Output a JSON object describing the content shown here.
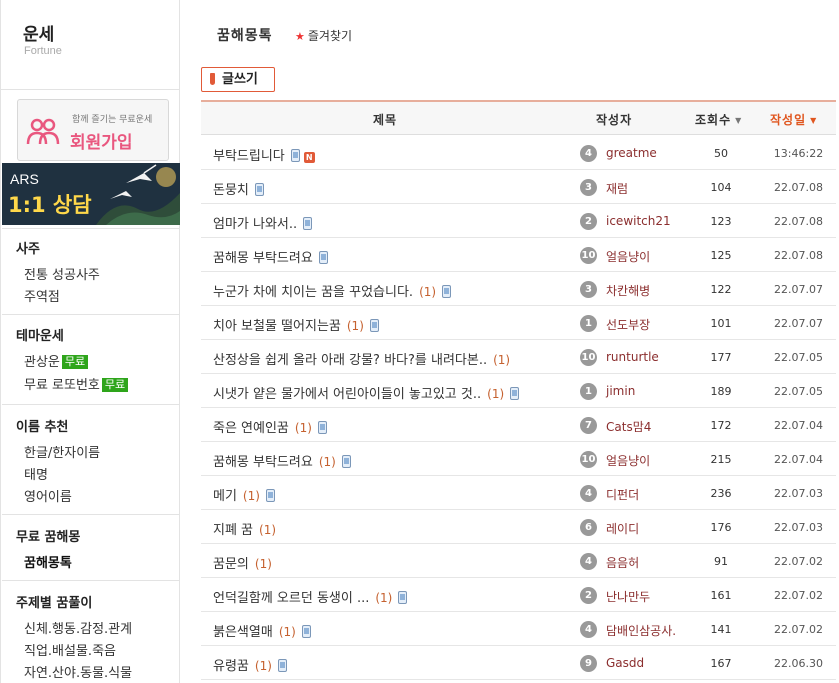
{
  "sidebar": {
    "title": "운세",
    "subtitle": "Fortune",
    "join_banner": {
      "top_text": "함께 즐기는 무료운세",
      "main_text": "회원가입"
    },
    "ars_banner": {
      "line1": "ARS",
      "line2": "1:1 상담"
    },
    "groups": [
      {
        "head": "사주",
        "items": [
          "전통 성공사주",
          "주역점"
        ]
      },
      {
        "head": "테마운세",
        "items": [
          "관상운",
          "무료 로또번호"
        ]
      },
      {
        "head": "이름 추천",
        "items": [
          "한글/한자이름",
          "태명",
          "영어이름"
        ]
      },
      {
        "head": "무료 꿈해몽",
        "items": [
          "꿈해몽톡"
        ]
      },
      {
        "head": "주제별 꿈풀이",
        "items": [
          "신체.행동.감정.관계",
          "직업.배설물.죽음",
          "자연.산야.동물.식물"
        ]
      }
    ],
    "free_badge": "무료"
  },
  "header": {
    "title": "꿈해몽톡",
    "favorite": "즐겨찾기"
  },
  "toolbar": {
    "write_label": "글쓰기"
  },
  "table": {
    "columns": {
      "title": "제목",
      "author": "작성자",
      "views": "조회수",
      "date": "작성일"
    },
    "rows": [
      {
        "title": "부탁드립니다",
        "comments": "",
        "mobile": true,
        "is_new": true,
        "level": "4",
        "author": "greatme",
        "views": "50",
        "date": "13:46:22"
      },
      {
        "title": "돈뭉치",
        "comments": "",
        "mobile": true,
        "is_new": false,
        "level": "3",
        "author": "재럼",
        "views": "104",
        "date": "22.07.08"
      },
      {
        "title": "엄마가 나와서..",
        "comments": "",
        "mobile": true,
        "is_new": false,
        "level": "2",
        "author": "icewitch21",
        "views": "123",
        "date": "22.07.08"
      },
      {
        "title": "꿈해몽 부탁드려요",
        "comments": "",
        "mobile": true,
        "is_new": false,
        "level": "10",
        "author": "얼음냥이",
        "views": "125",
        "date": "22.07.08"
      },
      {
        "title": "누군가 차에 치이는 꿈을 꾸었습니다.",
        "comments": "(1)",
        "mobile": true,
        "is_new": false,
        "level": "3",
        "author": "차칸해병",
        "views": "122",
        "date": "22.07.07"
      },
      {
        "title": "치아 보철물 떨어지는꿈",
        "comments": "(1)",
        "mobile": true,
        "is_new": false,
        "level": "1",
        "author": "선도부장",
        "views": "101",
        "date": "22.07.07"
      },
      {
        "title": "산정상을 쉽게 올라 아래 강물? 바다?를 내려다본..",
        "comments": "(1)",
        "mobile": false,
        "is_new": false,
        "level": "10",
        "author": "runturtle",
        "views": "177",
        "date": "22.07.05"
      },
      {
        "title": "시냇가 얕은 물가에서 어린아이들이 놓고있고 것..",
        "comments": "(1)",
        "mobile": true,
        "is_new": false,
        "level": "1",
        "author": "jimin",
        "views": "189",
        "date": "22.07.05"
      },
      {
        "title": "죽은 연예인꿈",
        "comments": "(1)",
        "mobile": true,
        "is_new": false,
        "level": "7",
        "author": "Cats맘4",
        "views": "172",
        "date": "22.07.04"
      },
      {
        "title": "꿈해몽 부탁드려요",
        "comments": "(1)",
        "mobile": true,
        "is_new": false,
        "level": "10",
        "author": "얼음냥이",
        "views": "215",
        "date": "22.07.04"
      },
      {
        "title": "메기",
        "comments": "(1)",
        "mobile": true,
        "is_new": false,
        "level": "4",
        "author": "디펀더",
        "views": "236",
        "date": "22.07.03"
      },
      {
        "title": "지폐 꿈",
        "comments": "(1)",
        "mobile": false,
        "is_new": false,
        "level": "6",
        "author": "레이디",
        "views": "176",
        "date": "22.07.03"
      },
      {
        "title": "꿈문의",
        "comments": "(1)",
        "mobile": false,
        "is_new": false,
        "level": "4",
        "author": "음음허",
        "views": "91",
        "date": "22.07.02"
      },
      {
        "title": "언덕길함께 오르던 동생이 ...",
        "comments": "(1)",
        "mobile": true,
        "is_new": false,
        "level": "2",
        "author": "난나만두",
        "views": "161",
        "date": "22.07.02"
      },
      {
        "title": "붉은색열매",
        "comments": "(1)",
        "mobile": true,
        "is_new": false,
        "level": "4",
        "author": "담배인삼공사.",
        "views": "141",
        "date": "22.07.02"
      },
      {
        "title": "유령꿈",
        "comments": "(1)",
        "mobile": true,
        "is_new": false,
        "level": "9",
        "author": "Gasdd",
        "views": "167",
        "date": "22.06.30"
      }
    ]
  },
  "colors": {
    "accent": "#e15a38",
    "free_badge": "#2ea51b",
    "author": "#8b2e2e",
    "comment_count": "#c5612f"
  },
  "icons": {
    "mobile": "mobile-phone-icon",
    "new": "new-badge-icon",
    "star": "star-icon"
  }
}
